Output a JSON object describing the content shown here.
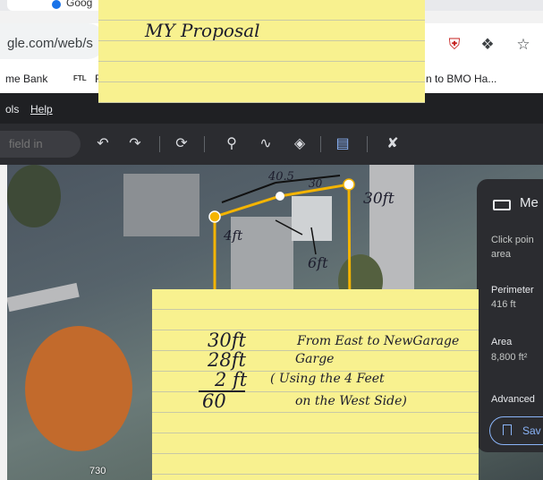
{
  "browser": {
    "tab_title": "Goog",
    "url": "gle.com/web/s",
    "bookmarks": [
      "me Bank",
      "FTL",
      "F",
      "n to BMO Ha..."
    ]
  },
  "menubar": {
    "items": [
      "ols",
      "Help"
    ]
  },
  "toolbar": {
    "search_placeholder": "field in",
    "tools": [
      "undo-icon",
      "redo-icon",
      "history-icon",
      "placemark-icon",
      "path-icon",
      "layers-icon",
      "ruler-icon",
      "measure-icon"
    ]
  },
  "map": {
    "annotations": {
      "top_length": "40.5",
      "top_right_length": "30",
      "right_length": "30ft",
      "left_length": "4ft",
      "lower_length": "6ft"
    },
    "house_number": "730"
  },
  "measure_panel": {
    "title": "Me",
    "instruction_line1": "Click poin",
    "instruction_line2": "area",
    "perimeter_label": "Perimeter",
    "perimeter_value": "416 ft",
    "area_label": "Area",
    "area_value": "8,800 ft²",
    "advanced_label": "Advanced",
    "save_label": "Sav"
  },
  "sticky_top": {
    "text": "MY Proposal"
  },
  "sticky_bottom": {
    "line1_num": "30ft",
    "line1_text": "From East to NewGarage",
    "line2_num": "28ft",
    "line2_text": "Garge",
    "line3_num": "2 ft",
    "line3_text": "( Using the 4 Feet",
    "line4_num": "60",
    "line4_text": "on the West Side)"
  },
  "colors": {
    "measure_line": "#f4b400",
    "sticky": "#f8f18f",
    "panel": "#2b2c30"
  }
}
